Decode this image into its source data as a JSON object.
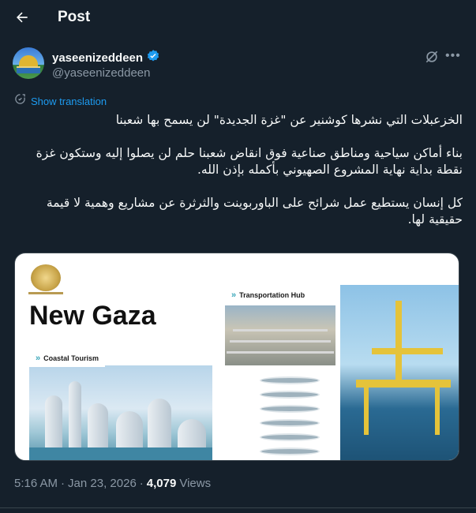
{
  "header": {
    "title": "Post"
  },
  "author": {
    "display_name": "yaseenizeddeen",
    "handle": "@yaseenizeddeen",
    "verified": true
  },
  "translate_label": "Show translation",
  "post": {
    "paragraphs": [
      "الخزعبلات التي نشرها كوشنير عن \"غزة الجديدة\" لن يسمح بها شعبنا",
      "بناء أماكن سياحية ومناطق صناعية فوق انقاض شعبنا حلم لن يصلوا إليه وستكون غزة نقطة بداية نهاية المشروع الصهيوني بأكمله بإذن الله.",
      "كل إنسان يستطيع عمل شرائح على الباوربوينت والثرثرة عن مشاريع وهمية لا قيمة حقيقية لها."
    ]
  },
  "media": {
    "headline": "New Gaza",
    "tags": {
      "transport": "Transportation Hub",
      "coastal": "Coastal Tourism"
    }
  },
  "meta": {
    "time": "5:16 AM",
    "separator": "·",
    "date": "Jan 23, 2026",
    "views_count": "4,079",
    "views_label": "Views"
  },
  "colors": {
    "background": "#15202b",
    "accent": "#1d9bf0",
    "muted": "#8b98a5",
    "verified": "#1d9bf0"
  },
  "icons": [
    "back-arrow-icon",
    "verified-badge-icon",
    "grok-icon",
    "more-icon",
    "translate-icon"
  ]
}
